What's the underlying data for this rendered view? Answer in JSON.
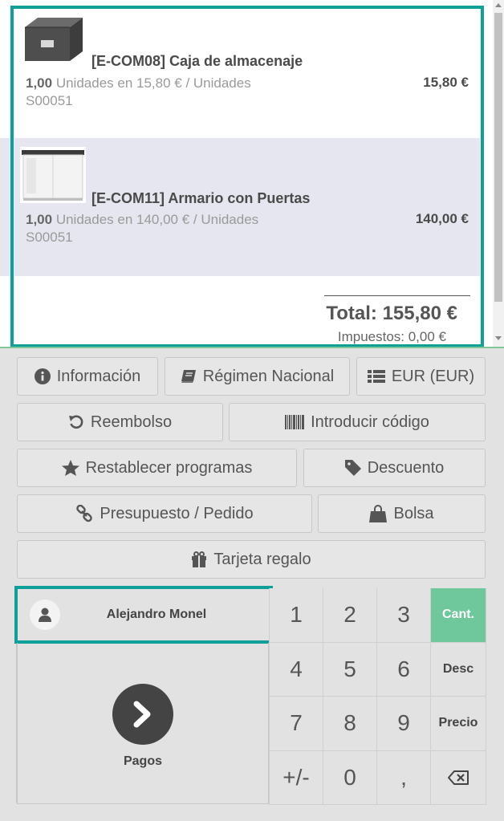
{
  "order": {
    "lines": [
      {
        "product": "[E-COM08] Caja de almacenaje",
        "qty": "1,00",
        "unit_text": " Unidades en 15,80 € / Unidades",
        "ref": "S00051",
        "price": "15,80 €"
      },
      {
        "product": "[E-COM11] Armario con Puertas",
        "qty": "1,00",
        "unit_text": " Unidades en 140,00 € / Unidades",
        "ref": "S00051",
        "price": "140,00 €"
      }
    ],
    "total": "Total: 155,80 €",
    "taxes": "Impuestos: 0,00 €"
  },
  "controls": {
    "info": "Información",
    "fiscal": "Régimen Nacional",
    "currency": "EUR (EUR)",
    "refund": "Reembolso",
    "enter_code": "Introducir código",
    "reset_programs": "Restablecer programas",
    "discount": "Descuento",
    "quotation": "Presupuesto / Pedido",
    "bag": "Bolsa",
    "gift_card": "Tarjeta regalo"
  },
  "customer": {
    "name": "Alejandro Monel"
  },
  "payment": {
    "label": "Pagos"
  },
  "numpad": {
    "keys": [
      "1",
      "2",
      "3",
      "4",
      "5",
      "6",
      "7",
      "8",
      "9",
      "+/-",
      "0",
      ","
    ],
    "modes": {
      "qty": "Cant.",
      "disc": "Desc",
      "price": "Precio"
    },
    "active_mode": "Cant."
  },
  "colors": {
    "highlight": "#0f9f99",
    "active_mode": "#6ec89b",
    "pay_button": "#444444"
  }
}
